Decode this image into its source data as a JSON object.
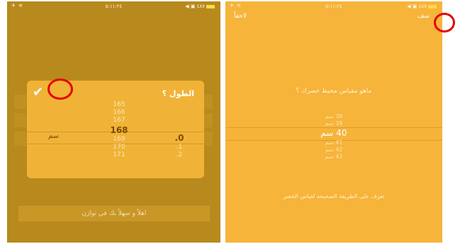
{
  "left_screen": {
    "status": {
      "left_icons": "✈ ≋",
      "time": "٥:١١:٢٤",
      "right_icons": "◀ ▣ ٤٨٧"
    },
    "modal": {
      "title": "الطول ؟",
      "confirm_icon": "✔",
      "height_values": [
        "165",
        "166",
        "167",
        "168",
        "169",
        "170",
        "171"
      ],
      "fraction_values": [
        ".0",
        ".1",
        ".2"
      ],
      "unit": "سم"
    },
    "bottom_text": "اهلاً و سهلاً بك في توازن"
  },
  "right_screen": {
    "status": {
      "left_icons": "✈ ≋",
      "time": "٥:١١:٢٤",
      "right_icons": "◀ ▣ ٤٨٧"
    },
    "skip_label": "لاحقاً",
    "next_label": "سف",
    "question": "ماهو مقياس محيط خصرك ؟",
    "waist_values": [
      "38 سم",
      "39 سم",
      "40 سم",
      "41 سم",
      "42 سم",
      "43 سم"
    ],
    "learn_link": "تعرف على الطريقة الصحيحة لقياس الخصر"
  },
  "colors": {
    "left_bg": "#b88a1d",
    "right_bg": "#f6b43a",
    "highlight_ring": "#e60000"
  }
}
